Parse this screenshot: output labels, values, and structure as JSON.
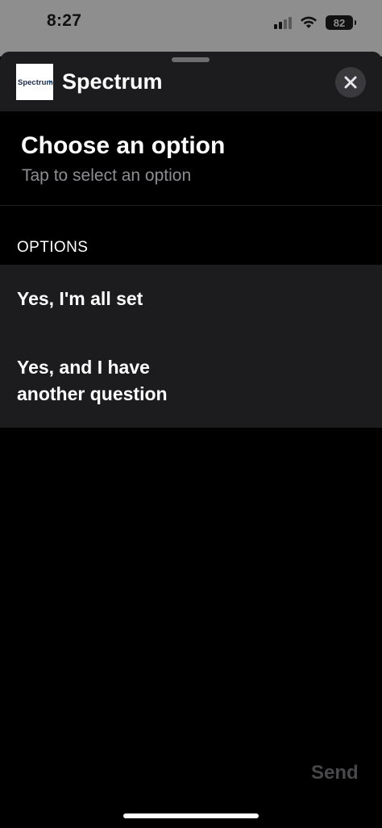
{
  "status_bar": {
    "time": "8:27",
    "battery": "82",
    "signal_bars_active": 2,
    "signal_bars_total": 4
  },
  "header": {
    "logo_text": "Spectrum",
    "logo_accent_color": "#0a5ca8",
    "title": "Spectrum",
    "close_icon": "close-icon"
  },
  "prompt": {
    "title": "Choose an option",
    "subtitle": "Tap to select an option"
  },
  "options": {
    "header": "OPTIONS",
    "items": [
      {
        "label": "Yes, I'm all set"
      },
      {
        "label": "Yes, and I have another question"
      }
    ]
  },
  "footer": {
    "send_label": "Send"
  },
  "colors": {
    "background": "#000000",
    "sheet_header": "#1c1c1e",
    "options_panel": "#1c1c1e",
    "subtitle_text": "#8d8d92",
    "disabled_text": "#48484a"
  }
}
